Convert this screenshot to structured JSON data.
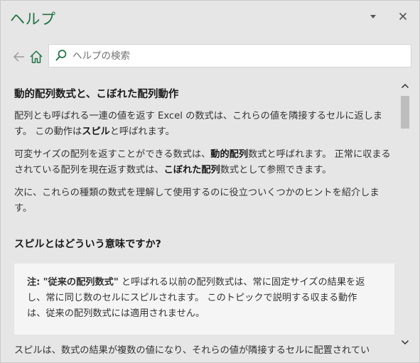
{
  "pane": {
    "title": "ヘルプ",
    "accent_color": "#217346",
    "icons": {
      "options": "chevron-down-icon",
      "close": "close-icon"
    }
  },
  "nav": {
    "back_icon": "back-arrow-icon",
    "home_icon": "home-icon"
  },
  "search": {
    "placeholder": "ヘルプの検索",
    "value": "",
    "icon": "search-icon"
  },
  "article": {
    "title": "動的配列数式と、こぼれた配列動作",
    "p1": {
      "a": "配列とも呼ばれる一連の値を返す Excel の数式は、これらの値を隣接するセルに返します。 この動作は",
      "b": "スピル",
      "c": "と呼ばれます。"
    },
    "p2": {
      "a": "可変サイズの配列を返すことができる数式は、",
      "b": "動的配列",
      "c": "数式と呼ばれます。 正常に収まるされている配列を現在返す数式は、",
      "d": "こぼれた配列",
      "e": "数式として参照できます。"
    },
    "p3": "次に、これらの種類の数式を理解して使用するのに役立ついくつかのヒントを紹介します。",
    "section_title": "スピルとはどういう意味ですか?",
    "note": {
      "label": "注:",
      "quoted": "\"従来の配列数式\"",
      "text": " と呼ばれる以前の配列数式は、常に固定サイズの結果を返し、常に同じ数のセルにスピルされます。 このトピックで説明する収まる動作は、従来の配列数式には適用されません。"
    },
    "p4": "スピルは、数式の結果が複数の値になり、それらの値が隣接するセルに配置されてい"
  },
  "scrollbar": {
    "up_icon": "chevron-up-icon",
    "down_icon": "chevron-down-icon",
    "position": 0.0
  }
}
